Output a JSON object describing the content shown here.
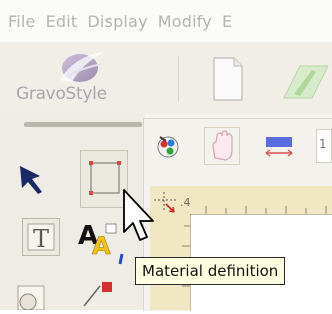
{
  "menu": {
    "items": [
      "File",
      "Edit",
      "Display",
      "Modify",
      "E"
    ]
  },
  "toolbar": {
    "logo_text": "GravoStyle"
  },
  "ruler": {
    "label": ".4"
  },
  "tooltip": {
    "text": "Material definition"
  },
  "colors": {
    "menu_text": "#b4b4b4",
    "ruler_bg": "#f2e7c3",
    "tooltip_bg": "#ffffe1"
  },
  "icons": [
    "new-document-icon",
    "open-icon",
    "select-arrow-icon",
    "rectangle-tool-icon",
    "text-tool-icon",
    "text-effects-icon",
    "color-palette-icon",
    "hand-pan-icon",
    "width-tool-icon",
    "origin-crosshair-icon",
    "mouse-cursor-icon"
  ]
}
